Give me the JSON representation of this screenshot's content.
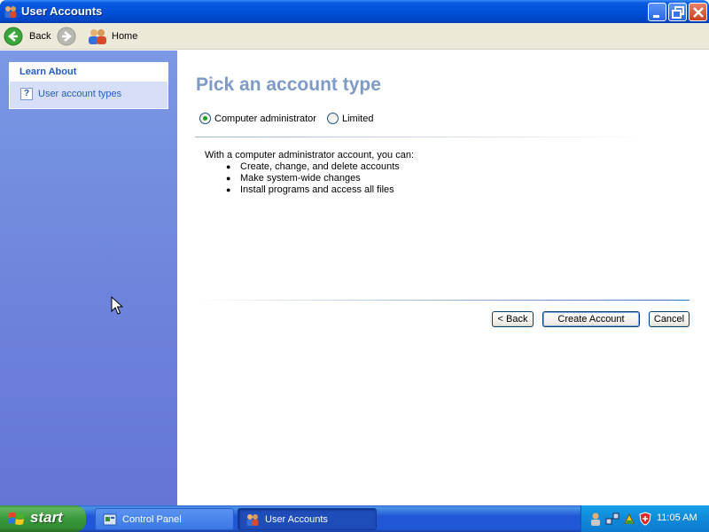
{
  "window": {
    "title": "User Accounts"
  },
  "toolbar": {
    "back_label": "Back",
    "home_label": "Home"
  },
  "sidebar": {
    "learn_about": {
      "header": "Learn About",
      "items": [
        {
          "label": "User account types",
          "icon": "help-icon"
        }
      ]
    }
  },
  "main": {
    "title": "Pick an account type",
    "account_types": [
      {
        "label": "Computer administrator",
        "selected": true
      },
      {
        "label": "Limited",
        "selected": false
      }
    ],
    "description": {
      "intro": "With a computer administrator account, you can:",
      "bullets": [
        "Create, change, and delete accounts",
        "Make system-wide changes",
        "Install programs and access all files"
      ]
    },
    "buttons": {
      "back": "< Back",
      "create": "Create Account",
      "cancel": "Cancel"
    }
  },
  "taskbar": {
    "start_label": "start",
    "tasks": [
      {
        "label": "Control Panel",
        "active": false
      },
      {
        "label": "User Accounts",
        "active": true
      }
    ],
    "clock": "11:05 AM"
  },
  "colors": {
    "title_bar": "#0050d8",
    "sidebar": "#6f85dc",
    "heading": "#7e9bc8",
    "link": "#215dc6",
    "start": "#3a9a3a",
    "tray": "#0f8ad8"
  }
}
